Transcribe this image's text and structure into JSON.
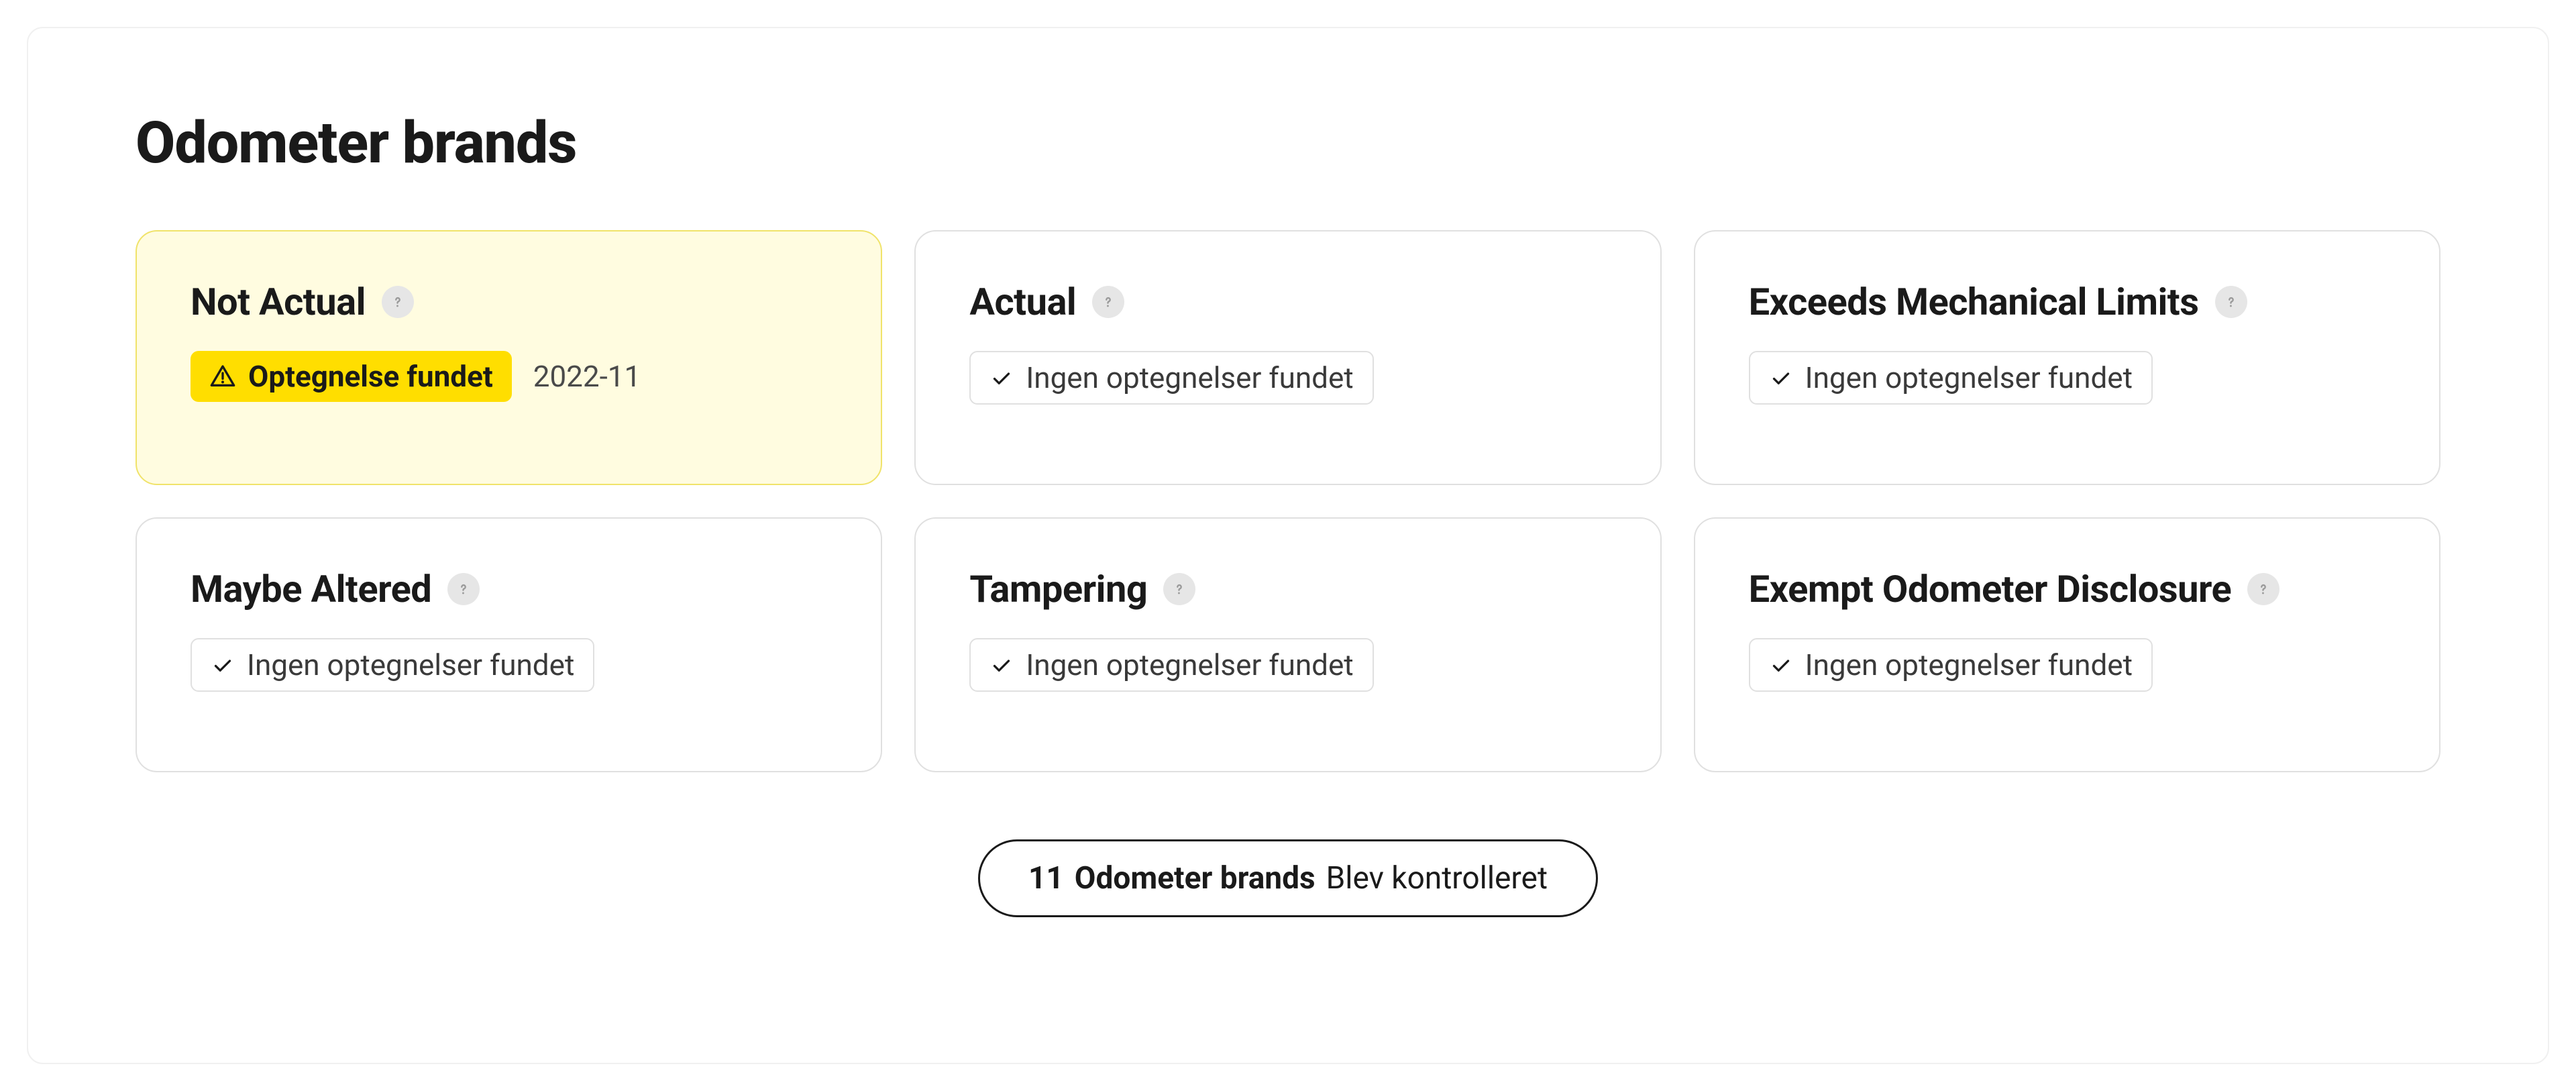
{
  "title": "Odometer brands",
  "badges": {
    "record_found": "Optegnelse fundet",
    "no_records": "Ingen optegnelser fundet"
  },
  "cards": [
    {
      "title": "Not Actual",
      "status": "found",
      "date": "2022-11"
    },
    {
      "title": "Actual",
      "status": "none"
    },
    {
      "title": "Exceeds Mechanical Limits",
      "status": "none"
    },
    {
      "title": "Maybe Altered",
      "status": "none"
    },
    {
      "title": "Tampering",
      "status": "none"
    },
    {
      "title": "Exempt Odometer Disclosure",
      "status": "none"
    }
  ],
  "summary": {
    "count": "11",
    "label": "Odometer brands",
    "tail": "Blev kontrolleret"
  }
}
